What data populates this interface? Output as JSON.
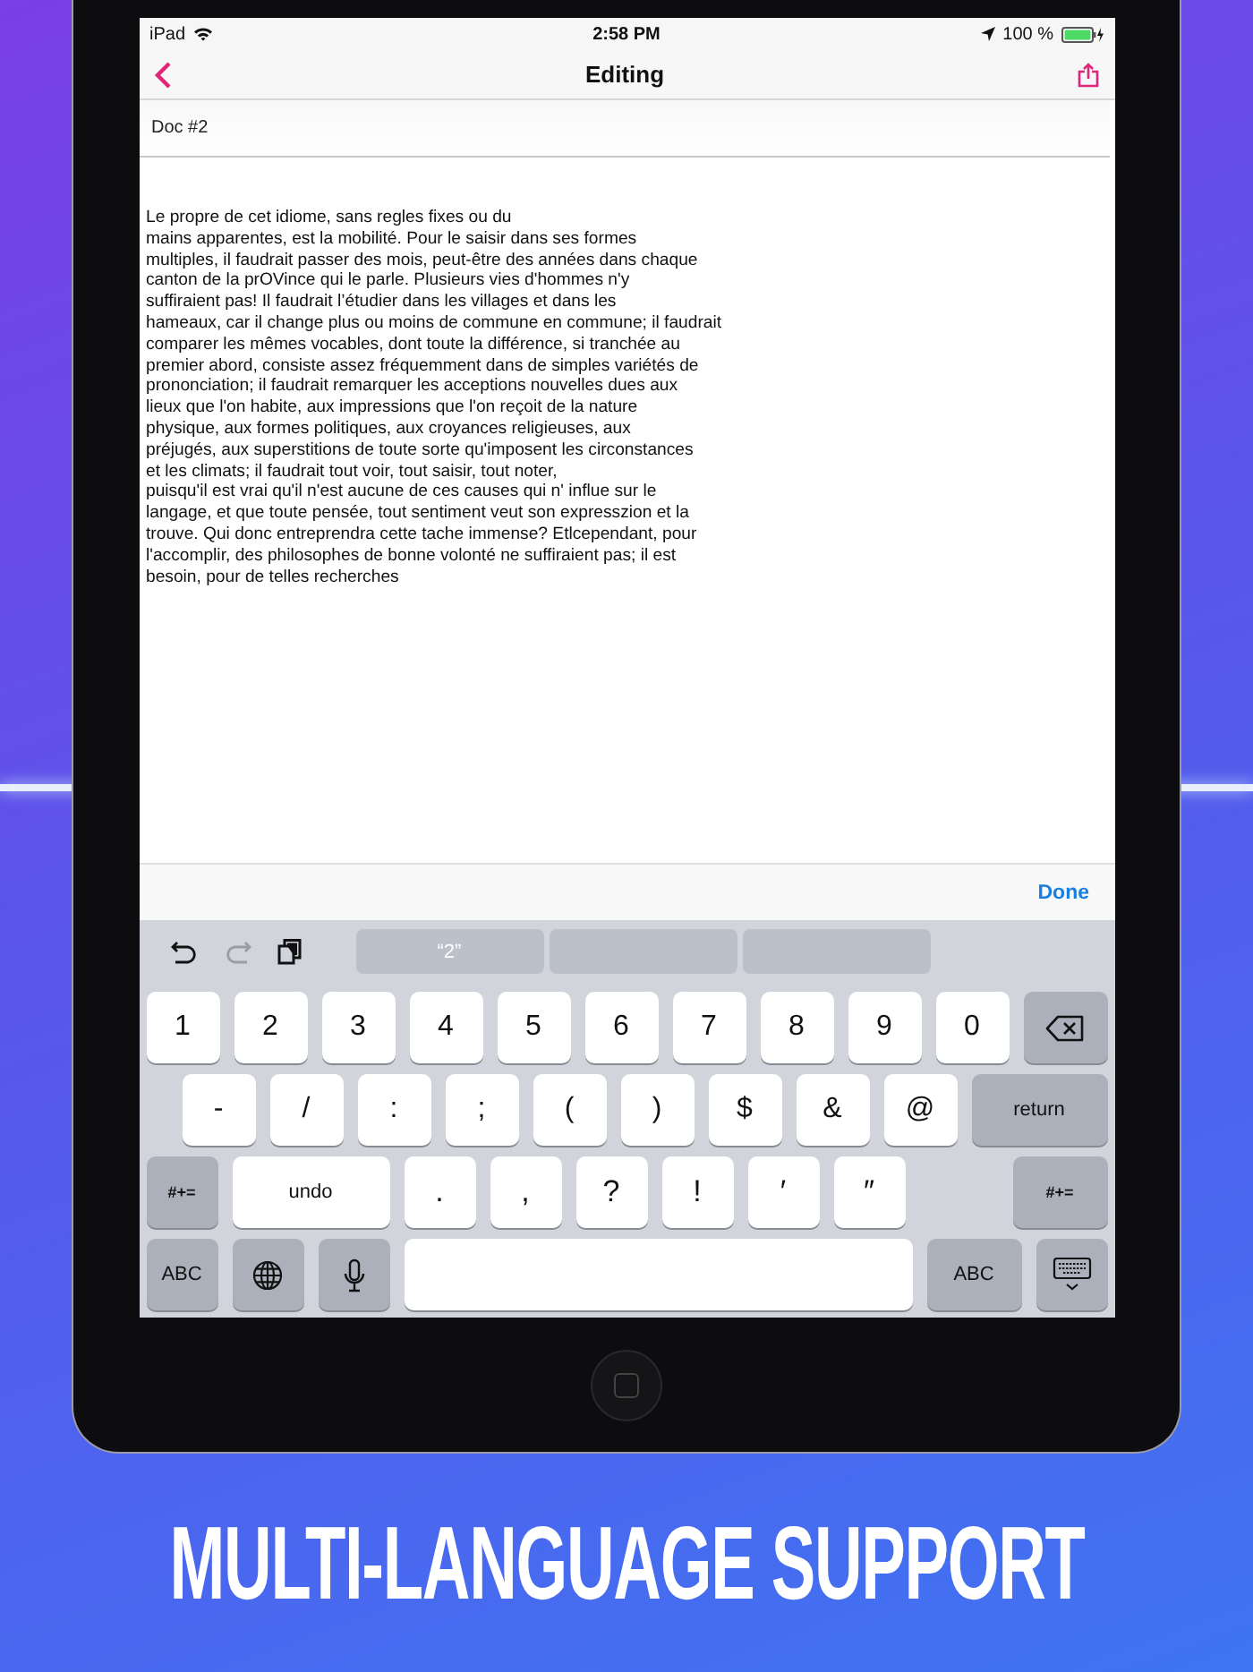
{
  "status_bar": {
    "device": "iPad",
    "time": "2:58 PM",
    "battery": "100 %"
  },
  "nav_bar": {
    "title": "Editing"
  },
  "document": {
    "title": "Doc #2",
    "body": "Le propre de cet idiome, sans regles fixes ou du\nmains apparentes, est la mobilité. Pour le saisir dans ses formes\nmultiples, il faudrait passer des mois, peut-être des années dans chaque\ncanton de la prOVince qui le parle. Plusieurs vies d'hommes n'y\nsuffiraient pas! Il faudrait l’étudier dans les villages et dans les\nhameaux, car il change plus ou moins de commune en commune; il faudrait\ncomparer les mêmes vocables, dont toute la différence, si tranchée au\npremier abord, consiste assez fréquemment dans de simples variétés de\nprononciation; il faudrait remarquer les acceptions nouvelles dues aux\nlieux que l'on habite, aux impressions que l'on reçoit de la nature\nphysique, aux formes politiques, aux croyances religieuses, aux\npréjugés, aux superstitions de toute sorte qu'imposent les circonstances\net les climats; il faudrait tout voir, tout saisir, tout noter,\npuisqu'il est vrai qu'il n'est aucune de ces causes qui n' influe sur le\nlangage, et que toute pensée, tout sentiment veut son expresszion et la\ntrouve. Qui donc entreprendra cette tache immense? Etlcependant, pour\nl'accomplir, des philosophes de bonne volonté ne suffiraient pas; il est\nbesoin, pour de telles recherches"
  },
  "accessory_bar": {
    "done": "Done"
  },
  "keyboard": {
    "shortcuts": [
      {
        "kind": "undo",
        "disabled": false
      },
      {
        "kind": "redo",
        "disabled": true
      },
      {
        "kind": "paste",
        "disabled": false
      }
    ],
    "suggestions": [
      "“2”"
    ],
    "rows": [
      [
        {
          "kind": "char",
          "label": "1"
        },
        {
          "kind": "char",
          "label": "2"
        },
        {
          "kind": "char",
          "label": "3"
        },
        {
          "kind": "char",
          "label": "4"
        },
        {
          "kind": "char",
          "label": "5"
        },
        {
          "kind": "char",
          "label": "6"
        },
        {
          "kind": "char",
          "label": "7"
        },
        {
          "kind": "char",
          "label": "8"
        },
        {
          "kind": "char",
          "label": "9"
        },
        {
          "kind": "char",
          "label": "0"
        },
        {
          "kind": "backspace"
        }
      ],
      [
        {
          "kind": "char",
          "label": "-"
        },
        {
          "kind": "char",
          "label": "/"
        },
        {
          "kind": "char",
          "label": ":"
        },
        {
          "kind": "char",
          "label": ";"
        },
        {
          "kind": "char",
          "label": "("
        },
        {
          "kind": "char",
          "label": ")"
        },
        {
          "kind": "char",
          "label": "$"
        },
        {
          "kind": "char",
          "label": "&"
        },
        {
          "kind": "char",
          "label": "@"
        },
        {
          "kind": "function",
          "label": "return"
        }
      ],
      [
        {
          "kind": "function",
          "label": "#+="
        },
        {
          "kind": "wide",
          "label": "undo"
        },
        {
          "kind": "char",
          "label": "."
        },
        {
          "kind": "char",
          "label": ","
        },
        {
          "kind": "char",
          "label": "?"
        },
        {
          "kind": "char",
          "label": "!"
        },
        {
          "kind": "char",
          "label": "′"
        },
        {
          "kind": "char",
          "label": "″"
        },
        {
          "kind": "function",
          "label": "#+="
        }
      ],
      [
        {
          "kind": "function",
          "label": "ABC"
        },
        {
          "kind": "globe"
        },
        {
          "kind": "mic"
        },
        {
          "kind": "space"
        },
        {
          "kind": "function",
          "label": "ABC"
        },
        {
          "kind": "dismiss"
        }
      ]
    ]
  },
  "caption": "MULTI-LANGUAGE SUPPORT"
}
